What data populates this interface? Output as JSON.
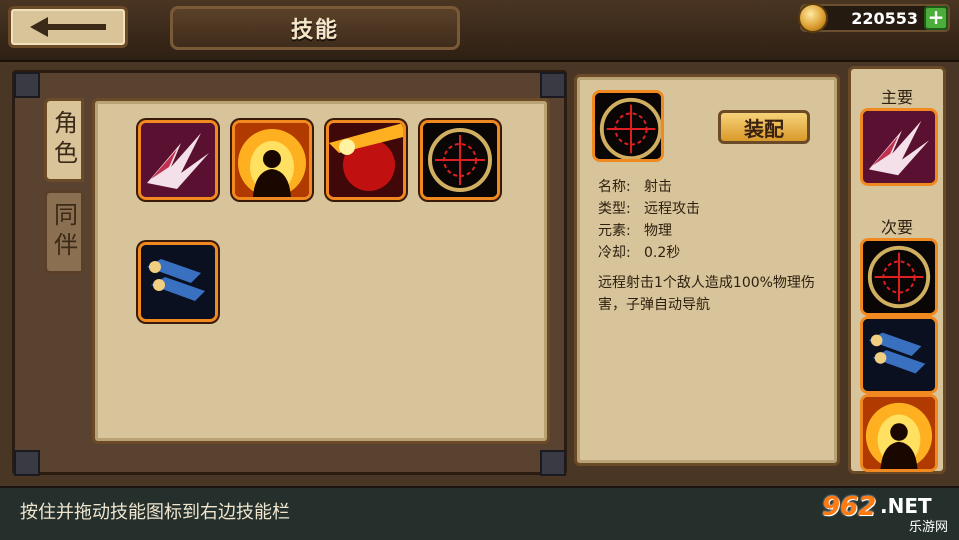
{
  "header": {
    "title": "技能",
    "coins": "220553",
    "add_label": "+"
  },
  "tabs": [
    {
      "label": "角色",
      "active": true
    },
    {
      "label": "同伴",
      "active": false
    }
  ],
  "skills": [
    {
      "name": "slash-skill",
      "icon": "claw-slash-icon"
    },
    {
      "name": "flame-aura-skill",
      "icon": "fire-silhouette-icon"
    },
    {
      "name": "fire-shield-skill",
      "icon": "red-shield-icon"
    },
    {
      "name": "shoot-skill",
      "icon": "crosshair-icon"
    },
    {
      "name": "missile-skill",
      "icon": "bullets-icon"
    }
  ],
  "detail": {
    "equip_label": "装配",
    "name_label": "名称:",
    "name_value": "射击",
    "type_label": "类型:",
    "type_value": "远程攻击",
    "element_label": "元素:",
    "element_value": "物理",
    "cooldown_label": "冷却:",
    "cooldown_value": "0.2秒",
    "description": "远程射击1个敌人造成100%物理伤害，子弹自动导航"
  },
  "slots": {
    "primary_label": "主要",
    "secondary_label": "次要"
  },
  "footer": {
    "hint": "按住并拖动技能图标到右边技能栏",
    "watermark_num": "962",
    "watermark_net": ".NET",
    "watermark_sub": "乐游网"
  },
  "colors": {
    "panel": "#d8c49a",
    "border": "#6b4a28",
    "skill_frame": "#f08a20",
    "coin": "#d99a2a",
    "add_button": "#4cae3a"
  }
}
